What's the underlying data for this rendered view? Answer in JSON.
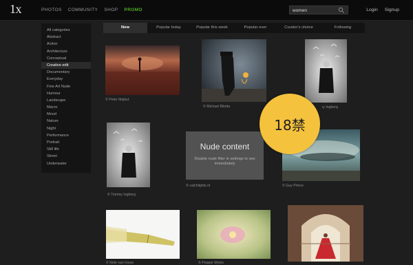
{
  "header": {
    "logo": "1x",
    "nav": [
      "PHOTOS",
      "COMMUNITY",
      "SHOP",
      "PROMO"
    ],
    "nav_active_color": "#4fae2a",
    "search_value": "women",
    "links": [
      "Login",
      "Signup"
    ]
  },
  "sidebar": {
    "items": [
      "All categories",
      "Abstract",
      "Action",
      "Architecture",
      "Conceptual",
      "Creative edit",
      "Documentary",
      "Everyday",
      "Fine Art Nude",
      "Humour",
      "Landscape",
      "Macro",
      "Mood",
      "Nature",
      "Night",
      "Performance",
      "Portrait",
      "Still life",
      "Street",
      "Underwater"
    ],
    "selected": "Creative edit"
  },
  "tabs": [
    "New",
    "Popular today",
    "Popular this week",
    "Popular ever",
    "Curator's choice",
    "Following"
  ],
  "photos": {
    "credits": [
      "© Peter Majkut",
      "© Michael Bilotta",
      "© Tommy Ingberg",
      "© Tommy Ingberg",
      "© catchlights.nl",
      "© Guy Prince",
      "© Nele van Irouw",
      "© Pepper Myles",
      ""
    ]
  },
  "nude_overlay": {
    "title": "Nude content",
    "text": "Disable nude filter in settings to see immediately",
    "badge": "18禁",
    "badge_color": "#f5c23d"
  }
}
